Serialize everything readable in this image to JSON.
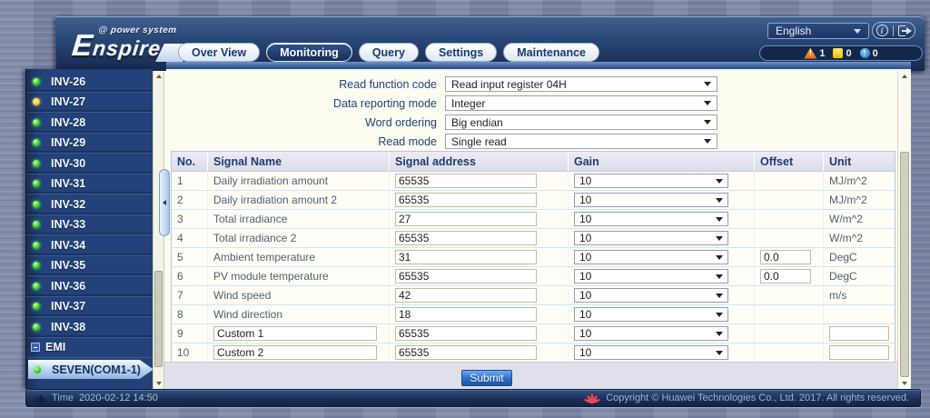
{
  "header": {
    "logo_sub": "@ power system",
    "logo_main": "Enspire",
    "language": "English",
    "info_icon_glyph": "i",
    "alarm_glyph": "!",
    "tabs": [
      {
        "label": "Over View",
        "active": false
      },
      {
        "label": "Monitoring",
        "active": true
      },
      {
        "label": "Query",
        "active": false
      },
      {
        "label": "Settings",
        "active": false
      },
      {
        "label": "Maintenance",
        "active": false
      }
    ],
    "alarms": [
      {
        "type": "critical",
        "count": "1"
      },
      {
        "type": "major",
        "count": "0"
      },
      {
        "type": "minor",
        "count": "0"
      }
    ]
  },
  "sidebar": {
    "items": [
      {
        "label": "INV-26",
        "status": "green"
      },
      {
        "label": "INV-27",
        "status": "yellow"
      },
      {
        "label": "INV-28",
        "status": "green"
      },
      {
        "label": "INV-29",
        "status": "green"
      },
      {
        "label": "INV-30",
        "status": "green"
      },
      {
        "label": "INV-31",
        "status": "green"
      },
      {
        "label": "INV-32",
        "status": "green"
      },
      {
        "label": "INV-33",
        "status": "green"
      },
      {
        "label": "INV-34",
        "status": "green"
      },
      {
        "label": "INV-35",
        "status": "green"
      },
      {
        "label": "INV-36",
        "status": "green"
      },
      {
        "label": "INV-37",
        "status": "green"
      },
      {
        "label": "INV-38",
        "status": "green"
      }
    ],
    "group_label": "EMI",
    "selected_item": {
      "label": "SEVEN(COM1-1)",
      "status": "green"
    }
  },
  "form": {
    "rows": [
      {
        "label": "Read function code",
        "value": "Read input register 04H"
      },
      {
        "label": "Data reporting mode",
        "value": "Integer"
      },
      {
        "label": "Word ordering",
        "value": "Big endian"
      },
      {
        "label": "Read mode",
        "value": "Single read"
      }
    ]
  },
  "table": {
    "headers": [
      "No.",
      "Signal Name",
      "Signal address",
      "Gain",
      "Offset",
      "Unit"
    ],
    "rows": [
      {
        "no": "1",
        "name": "Daily irradiation amount",
        "name_input": false,
        "address": "65535",
        "gain": "10",
        "offset": null,
        "unit": "MJ/m^2",
        "unit_input": false
      },
      {
        "no": "2",
        "name": "Daily irradiation amount 2",
        "name_input": false,
        "address": "65535",
        "gain": "10",
        "offset": null,
        "unit": "MJ/m^2",
        "unit_input": false
      },
      {
        "no": "3",
        "name": "Total irradiance",
        "name_input": false,
        "address": "27",
        "gain": "10",
        "offset": null,
        "unit": "W/m^2",
        "unit_input": false
      },
      {
        "no": "4",
        "name": "Total irradiance 2",
        "name_input": false,
        "address": "65535",
        "gain": "10",
        "offset": null,
        "unit": "W/m^2",
        "unit_input": false
      },
      {
        "no": "5",
        "name": "Ambient temperature",
        "name_input": false,
        "address": "31",
        "gain": "10",
        "offset": "0.0",
        "unit": "DegC",
        "unit_input": false
      },
      {
        "no": "6",
        "name": "PV module temperature",
        "name_input": false,
        "address": "65535",
        "gain": "10",
        "offset": "0.0",
        "unit": "DegC",
        "unit_input": false
      },
      {
        "no": "7",
        "name": "Wind speed",
        "name_input": false,
        "address": "42",
        "gain": "10",
        "offset": null,
        "unit": "m/s",
        "unit_input": false
      },
      {
        "no": "8",
        "name": "Wind direction",
        "name_input": false,
        "address": "18",
        "gain": "10",
        "offset": null,
        "unit": "",
        "unit_input": false
      },
      {
        "no": "9",
        "name": "Custom 1",
        "name_input": true,
        "address": "65535",
        "gain": "10",
        "offset": null,
        "unit": "",
        "unit_input": true
      },
      {
        "no": "10",
        "name": "Custom 2",
        "name_input": true,
        "address": "65535",
        "gain": "10",
        "offset": null,
        "unit": "",
        "unit_input": true
      }
    ]
  },
  "submit_label": "Submit",
  "footer": {
    "time_label": "Time",
    "time_value": "2020-02-12 14:50",
    "copyright": "Copyright © Huawei Technologies Co., Ltd. 2017. All rights reserved."
  },
  "colors": {
    "accent_navy": "#1d3a6e",
    "status_green": "#3fd11f",
    "status_yellow": "#ffd31d",
    "alarm_critical": "#e8650f",
    "alarm_major": "#efc400",
    "alarm_minor": "#1d72ca"
  }
}
